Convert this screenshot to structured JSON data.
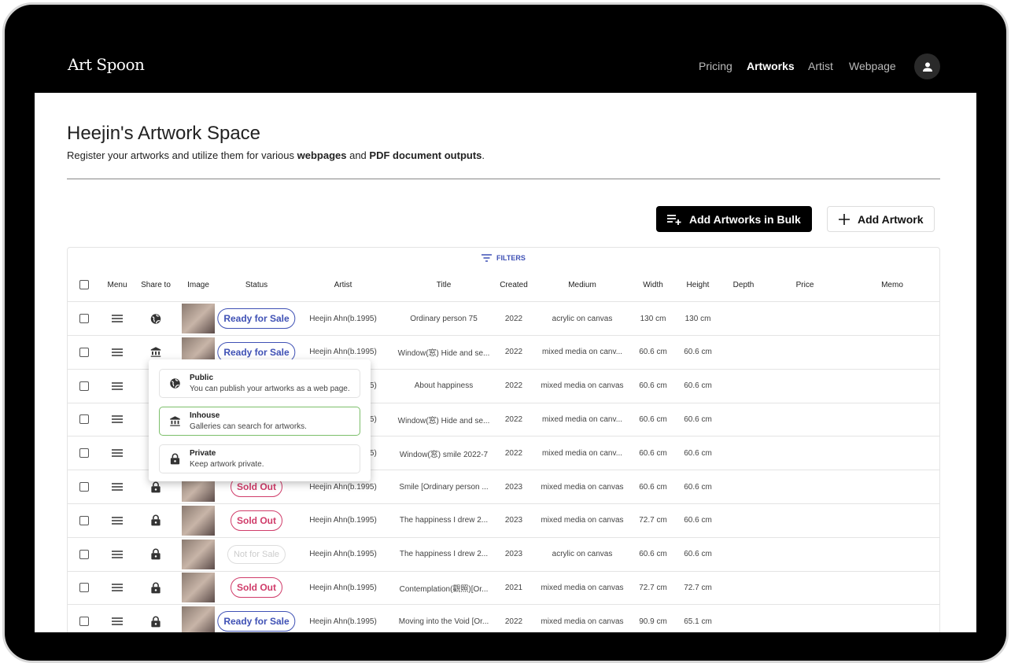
{
  "header": {
    "logo": "Art Spoon",
    "nav": [
      {
        "label": "Pricing",
        "active": false
      },
      {
        "label": "Artworks",
        "active": true
      },
      {
        "label": "Artist",
        "active": false
      },
      {
        "label": "Webpage",
        "active": false
      }
    ]
  },
  "page": {
    "title": "Heejin's Artwork Space",
    "subtitle_pre": "Register your artworks and utilize them for various ",
    "subtitle_b1": "webpages",
    "subtitle_mid": " and ",
    "subtitle_b2": "PDF document outputs",
    "subtitle_end": "."
  },
  "toolbar": {
    "bulk": "Add Artworks in Bulk",
    "add": "Add Artwork"
  },
  "table": {
    "filters": "FILTERS",
    "columns": [
      "Menu",
      "Share to",
      "Image",
      "Status",
      "Artist",
      "Title",
      "Created",
      "Medium",
      "Width",
      "Height",
      "Depth",
      "Price",
      "Memo"
    ],
    "rows": [
      {
        "share": "globe",
        "status": "Ready for Sale",
        "status_type": "ready",
        "artist": "Heejin Ahn(b.1995)",
        "title": "Ordinary person 75",
        "created": "2022",
        "medium": "acrylic on canvas",
        "width": "130 cm",
        "height": "130 cm"
      },
      {
        "share": "bank",
        "status": "Ready for Sale",
        "status_type": "ready",
        "artist": "Heejin Ahn(b.1995)",
        "title": "Window(窓) Hide and se...",
        "created": "2022",
        "medium": "mixed media on canv...",
        "width": "60.6 cm",
        "height": "60.6 cm"
      },
      {
        "share": null,
        "status": null,
        "status_type": null,
        "artist": "Heejin Ahn(b.1995)",
        "title": "About happiness",
        "created": "2022",
        "medium": "mixed media on canvas",
        "width": "60.6 cm",
        "height": "60.6 cm"
      },
      {
        "share": null,
        "status": null,
        "status_type": null,
        "artist": "Heejin Ahn(b.1995)",
        "title": "Window(窓) Hide and se...",
        "created": "2022",
        "medium": "mixed media on canv...",
        "width": "60.6 cm",
        "height": "60.6 cm"
      },
      {
        "share": null,
        "status": null,
        "status_type": null,
        "artist": "Heejin Ahn(b.1995)",
        "title": "Window(窓) smile 2022-7",
        "created": "2022",
        "medium": "mixed media on canv...",
        "width": "60.6 cm",
        "height": "60.6 cm"
      },
      {
        "share": "lock",
        "status": "Sold Out",
        "status_type": "sold",
        "artist": "Heejin Ahn(b.1995)",
        "title": "Smile [Ordinary person ...",
        "created": "2023",
        "medium": "mixed media on canvas",
        "width": "60.6 cm",
        "height": "60.6 cm"
      },
      {
        "share": "lock",
        "status": "Sold Out",
        "status_type": "sold",
        "artist": "Heejin Ahn(b.1995)",
        "title": "The happiness I drew 2...",
        "created": "2023",
        "medium": "mixed media on canvas",
        "width": "72.7 cm",
        "height": "60.6 cm"
      },
      {
        "share": "lock",
        "status": "Not for Sale",
        "status_type": "nfs",
        "artist": "Heejin Ahn(b.1995)",
        "title": "The happiness I drew 2...",
        "created": "2023",
        "medium": "acrylic on canvas",
        "width": "60.6 cm",
        "height": "60.6 cm"
      },
      {
        "share": "lock",
        "status": "Sold Out",
        "status_type": "sold",
        "artist": "Heejin Ahn(b.1995)",
        "title": "Contemplation(觀照)[Or...",
        "created": "2021",
        "medium": "mixed media on canvas",
        "width": "72.7 cm",
        "height": "72.7 cm"
      },
      {
        "share": "lock",
        "status": "Ready for Sale",
        "status_type": "ready",
        "artist": "Heejin Ahn(b.1995)",
        "title": "Moving into the Void [Or...",
        "created": "2022",
        "medium": "mixed media on canvas",
        "width": "90.9 cm",
        "height": "65.1 cm"
      }
    ]
  },
  "share_popover": {
    "options": [
      {
        "icon": "globe",
        "title": "Public",
        "desc": "You can publish your artworks as a web page.",
        "selected": false
      },
      {
        "icon": "bank",
        "title": "Inhouse",
        "desc": "Galleries can search for artworks.",
        "selected": true
      },
      {
        "icon": "lock",
        "title": "Private",
        "desc": "Keep artwork private.",
        "selected": false
      }
    ]
  },
  "colors": {
    "ready": "#3f51b5",
    "sold": "#d03c6a",
    "selected_border": "#7cbf6a"
  }
}
